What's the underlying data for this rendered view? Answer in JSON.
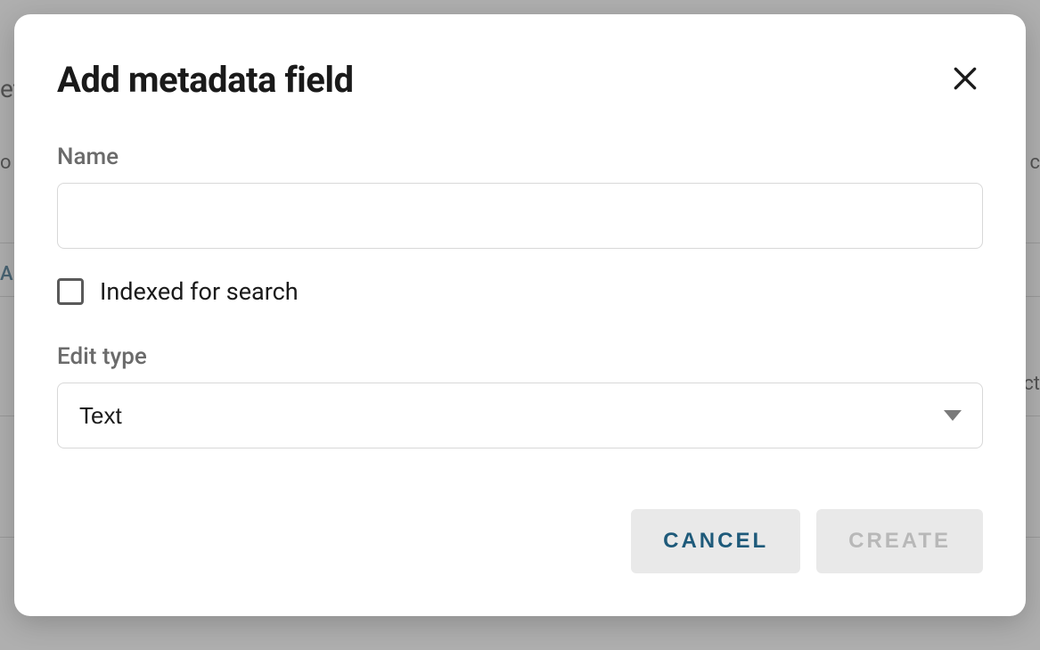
{
  "modal": {
    "title": "Add metadata field",
    "name_label": "Name",
    "name_value": "",
    "indexed_label": "Indexed for search",
    "indexed_checked": false,
    "edit_type_label": "Edit type",
    "edit_type_value": "Text",
    "cancel_label": "CANCEL",
    "create_label": "CREATE"
  },
  "background": {
    "left_fragment1": "et",
    "left_fragment2": "o",
    "tab_fragment": "A",
    "right_fragment1": "c",
    "right_fragment2": "ct"
  }
}
